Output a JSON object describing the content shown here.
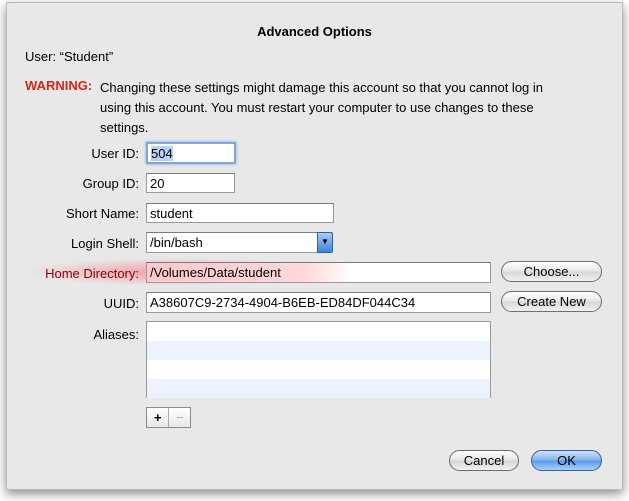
{
  "dialog": {
    "title": "Advanced Options",
    "user_line": "User: “Student”",
    "warning_label": "WARNING:",
    "warning_lines": [
      "Changing these settings might damage this account so that you cannot log in",
      "using this account. You must restart your computer to use changes to these",
      "settings."
    ]
  },
  "fields": {
    "user_id": {
      "label": "User ID:",
      "value": "504"
    },
    "group_id": {
      "label": "Group ID:",
      "value": "20"
    },
    "short_name": {
      "label": "Short Name:",
      "value": "student"
    },
    "login_shell": {
      "label": "Login Shell:",
      "value": "/bin/bash"
    },
    "home_directory": {
      "label": "Home Directory:",
      "value": "/Volumes/Data/student"
    },
    "uuid": {
      "label": "UUID:",
      "value": "A38607C9-2734-4904-B6EB-ED84DF044C34"
    },
    "aliases": {
      "label": "Aliases:",
      "items": []
    }
  },
  "buttons": {
    "choose": "Choose...",
    "create_new": "Create New",
    "add": "+",
    "remove": "−",
    "cancel": "Cancel",
    "ok": "OK"
  },
  "colors": {
    "warning": "#d8261c",
    "highlight": "#8b0000",
    "accent": "#5a98e6"
  }
}
